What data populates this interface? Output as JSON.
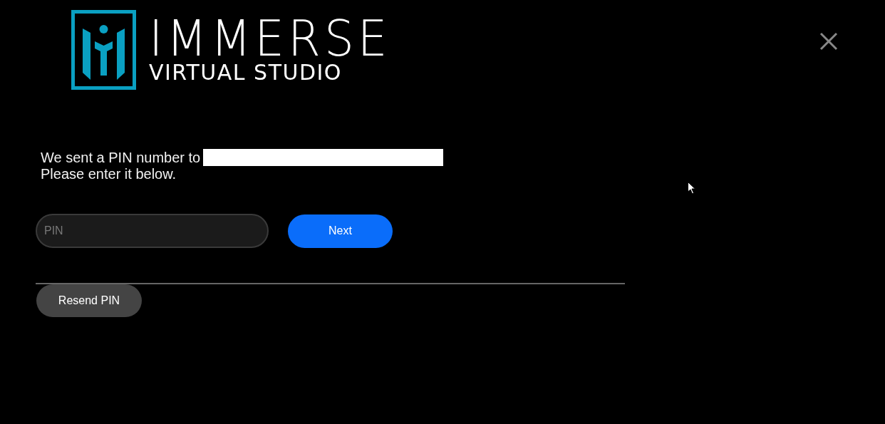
{
  "logo": {
    "title": "IMMERSE",
    "subtitle": "VIRTUAL STUDIO"
  },
  "message": {
    "line_1": "We sent a PIN number to",
    "line_2": "Please enter it below."
  },
  "pin_field": {
    "placeholder": "PIN"
  },
  "buttons": [
    {
      "label": "Next",
      "kind": "primary"
    },
    {
      "label": "Resend PIN",
      "kind": "secondary"
    }
  ]
}
